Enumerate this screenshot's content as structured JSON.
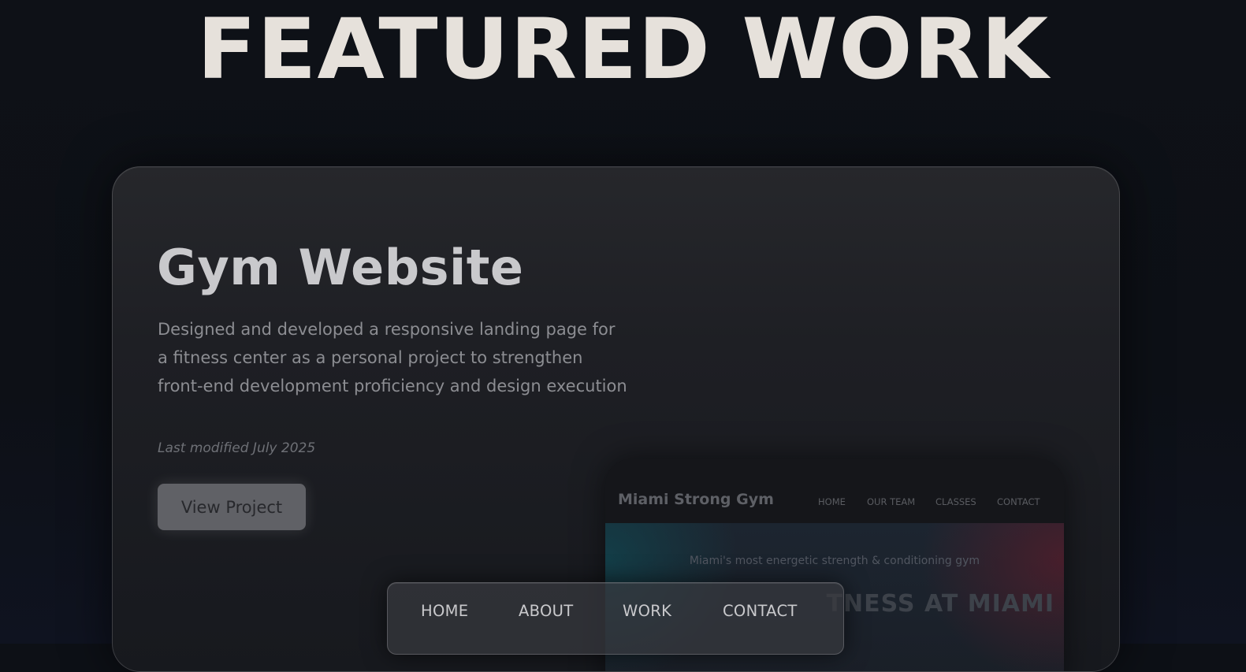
{
  "section": {
    "heading": "FEATURED WORK"
  },
  "project": {
    "title": "Gym Website",
    "description": "Designed and developed a responsive landing page for a fitness center as a personal project to strengthen front-end development proficiency and design execution",
    "last_modified": "Last modified July 2025",
    "button_label": "View Project"
  },
  "preview": {
    "brand": "Miami Strong Gym",
    "nav": [
      "HOME",
      "OUR TEAM",
      "CLASSES",
      "CONTACT"
    ],
    "tagline": "Miami's most energetic strength & conditioning gym",
    "headline": "TNESS AT MIAMI"
  },
  "nav": {
    "items": [
      "HOME",
      "ABOUT",
      "WORK",
      "CONTACT"
    ]
  }
}
